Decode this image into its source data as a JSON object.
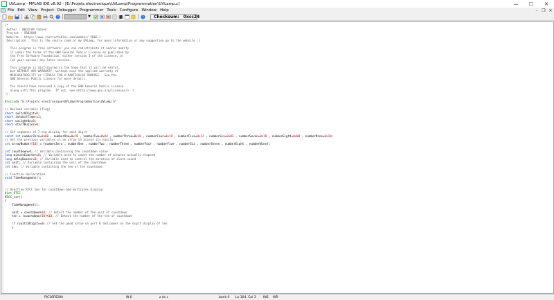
{
  "window": {
    "title": "UVLamp - MPLAB IDE v8.92 - [E:\\Projets electronique\\UVLamp\\Programmation\\UVLamp.c]",
    "controls": [
      "—",
      "☐",
      "✕"
    ]
  },
  "menubar": {
    "items": [
      "File",
      "Edit",
      "View",
      "Project",
      "Debugger",
      "Programmer",
      "Tools",
      "Configure",
      "Window",
      "Help"
    ],
    "mdi_controls": [
      "–",
      "❐",
      "✕"
    ]
  },
  "toolbar": {
    "checksum_label": "Checksum:",
    "checksum_value": "0xcc24"
  },
  "editor": {
    "lines": [
      [
        [
          "c-com",
          "/*"
        ]
      ],
      [
        [
          "c-com",
          " Author : NEDIFAR Fabien"
        ]
      ],
      [
        [
          "c-com",
          " Project : SR02048"
        ]
      ],
      [
        [
          "c-com",
          " Website : https://www.instructables.com/member/-SR02-/"
        ]
      ],
      [
        [
          "c-com",
          " Description : This is the source code of my UVLamp, for more information or any suggestion go to the website :)"
        ]
      ],
      [
        [
          "c-com",
          ""
        ]
      ],
      [
        [
          "c-com",
          "   This program is free software: you can redistribute it and/or modify"
        ]
      ],
      [
        [
          "c-com",
          "   it under the terms of the GNU General Public License as published by"
        ]
      ],
      [
        [
          "c-com",
          "   the Free Software Foundation, either version 3 of the License, or"
        ]
      ],
      [
        [
          "c-com",
          "   (at your option) any later version."
        ]
      ],
      [
        [
          "c-com",
          ""
        ]
      ],
      [
        [
          "c-com",
          "   This program is distributed in the hope that it will be useful,"
        ]
      ],
      [
        [
          "c-com",
          "   but WITHOUT ANY WARRANTY; without even the implied warranty of"
        ]
      ],
      [
        [
          "c-com",
          "   MERCHANTABILITY or FITNESS FOR A PARTICULAR PURPOSE.  See the"
        ]
      ],
      [
        [
          "c-com",
          "   GNU General Public License for more details."
        ]
      ],
      [
        [
          "c-com",
          ""
        ]
      ],
      [
        [
          "c-com",
          "   You should have received a copy of the GNU General Public License"
        ]
      ],
      [
        [
          "c-com",
          "   along with this program.  If not, see <http://www.gnu.org/licenses/>. l"
        ]
      ],
      [
        [
          "c-com",
          "*/"
        ]
      ],
      [
        [
          "c-txt",
          ""
        ]
      ],
      [
        [
          "c-pp",
          "#include "
        ],
        [
          "c-str",
          "\"E:\\Projets electronique\\UVLamp\\Programmation\\UVLamp.h\""
        ]
      ],
      [
        [
          "c-txt",
          ""
        ]
      ],
      [
        [
          "c-com",
          "// Boolean variable (flag)"
        ]
      ],
      [
        [
          "c-kw",
          "short"
        ],
        [
          "c-txt",
          " switchDigit="
        ],
        [
          "c-num",
          "0"
        ],
        [
          "c-txt",
          ";"
        ]
      ],
      [
        [
          "c-kw",
          "short"
        ],
        [
          "c-txt",
          " inhibitTimer="
        ],
        [
          "c-num",
          "1"
        ],
        [
          "c-txt",
          ";"
        ]
      ],
      [
        [
          "c-kw",
          "short"
        ],
        [
          "c-txt",
          " uvLightOn="
        ],
        [
          "c-num",
          "0"
        ],
        [
          "c-txt",
          ";"
        ]
      ],
      [
        [
          "c-kw",
          "short"
        ],
        [
          "c-txt",
          " startBuzzer="
        ],
        [
          "c-num",
          "0"
        ],
        [
          "c-txt",
          ";"
        ]
      ],
      [
        [
          "c-txt",
          ""
        ]
      ],
      [
        [
          "c-com",
          "// Set segments of 7-seg display for each digit"
        ]
      ],
      [
        [
          "c-kw",
          "const int"
        ],
        [
          "c-txt",
          " numberZero="
        ],
        [
          "c-num",
          "0x60"
        ],
        [
          "c-txt",
          " , numberOne="
        ],
        [
          "c-num",
          "0x7B"
        ],
        [
          "c-txt",
          " , numberTwo="
        ],
        [
          "c-num",
          "0xA4"
        ],
        [
          "c-txt",
          " , numberThree="
        ],
        [
          "c-num",
          "0x30"
        ],
        [
          "c-txt",
          " , numberFour="
        ],
        [
          "c-num",
          "0x19"
        ],
        [
          "c-txt",
          " , numberFive="
        ],
        [
          "c-num",
          "0x12"
        ],
        [
          "c-txt",
          " , numberSix="
        ],
        [
          "c-num",
          "0x02"
        ],
        [
          "c-txt",
          " , numberSeven="
        ],
        [
          "c-num",
          "0x78"
        ],
        [
          "c-txt",
          " , numberEight="
        ],
        [
          "c-num",
          "0x00"
        ],
        [
          "c-txt",
          " , numberNine="
        ],
        [
          "c-num",
          "0x10"
        ],
        [
          "c-txt",
          ";"
        ]
      ],
      [
        [
          "c-com",
          "// Set the previous variables in an array to access its easily"
        ]
      ],
      [
        [
          "c-kw",
          "int"
        ],
        [
          "c-txt",
          " arrayNumber["
        ],
        [
          "c-num",
          "10"
        ],
        [
          "c-txt",
          "] = {numberZero , numberOne , numberTwo , numberThree , numberFour , numberFive , numberSix , numberSeven , numberEight , numberNine};"
        ]
      ],
      [
        [
          "c-txt",
          ""
        ]
      ],
      [
        [
          "c-kw",
          "int"
        ],
        [
          "c-txt",
          " countdown="
        ],
        [
          "c-num",
          "0"
        ],
        [
          "c-txt",
          "; "
        ],
        [
          "c-com",
          "// Variable containing the countdown value"
        ]
      ],
      [
        [
          "c-kw",
          "long"
        ],
        [
          "c-txt",
          " minuteCounter="
        ],
        [
          "c-num",
          "0"
        ],
        [
          "c-txt",
          "; "
        ],
        [
          "c-com",
          "// Variable used to count the number of minutes actually elapsed"
        ]
      ],
      [
        [
          "c-kw",
          "long"
        ],
        [
          "c-txt",
          " delayBuzzer="
        ],
        [
          "c-num",
          "0"
        ],
        [
          "c-txt",
          "; "
        ],
        [
          "c-com",
          "// Variable used to control the duration of alarm sound"
        ]
      ],
      [
        [
          "c-kw",
          "int"
        ],
        [
          "c-txt",
          " unit; "
        ],
        [
          "c-com",
          "// Variable containing the unit of the countdown"
        ]
      ],
      [
        [
          "c-kw",
          "int"
        ],
        [
          "c-txt",
          " ten; "
        ],
        [
          "c-com",
          "// Variable containing the ten of the countdown"
        ]
      ],
      [
        [
          "c-txt",
          ""
        ]
      ],
      [
        [
          "c-com",
          "// Function declaration"
        ]
      ],
      [
        [
          "c-kw",
          "void"
        ],
        [
          "c-txt",
          " TimeManagment();"
        ]
      ],
      [
        [
          "c-txt",
          ""
        ]
      ],
      [
        [
          "c-txt",
          ""
        ]
      ],
      [
        [
          "c-com",
          "// Overflow RTCC 2ms for countdown and multiplex display"
        ]
      ],
      [
        [
          "c-pp",
          "#int_RTCC"
        ]
      ],
      [
        [
          "c-txt",
          "RTCC_isr()"
        ]
      ],
      [
        [
          "c-txt",
          "{"
        ]
      ],
      [
        [
          "c-txt",
          "    TimeManagment();"
        ]
      ],
      [
        [
          "c-txt",
          ""
        ]
      ],
      [
        [
          "c-txt",
          "    unit = countdown%"
        ],
        [
          "c-num",
          "10"
        ],
        [
          "c-txt",
          "; "
        ],
        [
          "c-com",
          "// Detect the number of the unit of countdown"
        ]
      ],
      [
        [
          "c-txt",
          "    ten = (countdown/"
        ],
        [
          "c-num",
          "10"
        ],
        [
          "c-txt",
          ")%"
        ],
        [
          "c-num",
          "10"
        ],
        [
          "c-txt",
          "; "
        ],
        [
          "c-com",
          "// Detect the number of the ten of countdown"
        ]
      ],
      [
        [
          "c-txt",
          ""
        ]
      ],
      [
        [
          "c-txt",
          "    "
        ],
        [
          "c-kw",
          "if"
        ],
        [
          "c-txt",
          " (switchDigit=="
        ],
        [
          "c-num",
          "0"
        ],
        [
          "c-txt",
          ") "
        ],
        [
          "c-com",
          "// Set the good value on port B and power on the digit display of ten"
        ]
      ],
      [
        [
          "c-txt",
          "    {"
        ]
      ]
    ]
  },
  "statusbar": {
    "device": "PIC16F628A",
    "w": "W:0",
    "flags": "z dc c",
    "bank": "bank 0",
    "position": "Ln 104, Col 3",
    "ins": "INS",
    "wr": "WR"
  }
}
